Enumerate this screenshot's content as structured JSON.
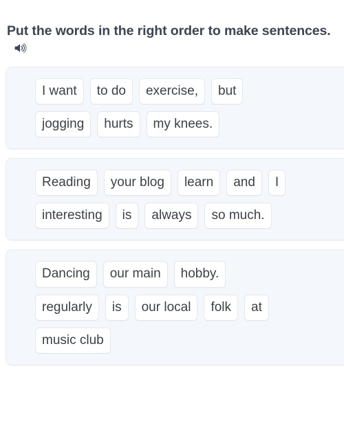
{
  "header": {
    "title": "Put the words in the right order to make sentences.",
    "audio_icon": "speaker-icon"
  },
  "colors": {
    "page_background": "#ffffff",
    "card_background": "#f4f7fb",
    "card_border": "#e7edf4",
    "chip_background": "#ffffff",
    "chip_border": "#e3e8ee",
    "chip_text": "#3c4147",
    "title_text": "#3d4451"
  },
  "cards": [
    {
      "rows": [
        [
          "I want",
          "to do",
          "exercise,",
          "but"
        ],
        [
          "jogging",
          "hurts",
          "my knees."
        ]
      ]
    },
    {
      "rows": [
        [
          "Reading",
          "your blog",
          "learn",
          "and",
          "I"
        ],
        [
          "interesting",
          "is",
          "always",
          "so much."
        ]
      ]
    },
    {
      "rows": [
        [
          "Dancing",
          "our main",
          "hobby."
        ],
        [
          "regularly",
          "is",
          "our local",
          "folk",
          "at"
        ],
        [
          "music club"
        ]
      ]
    }
  ]
}
